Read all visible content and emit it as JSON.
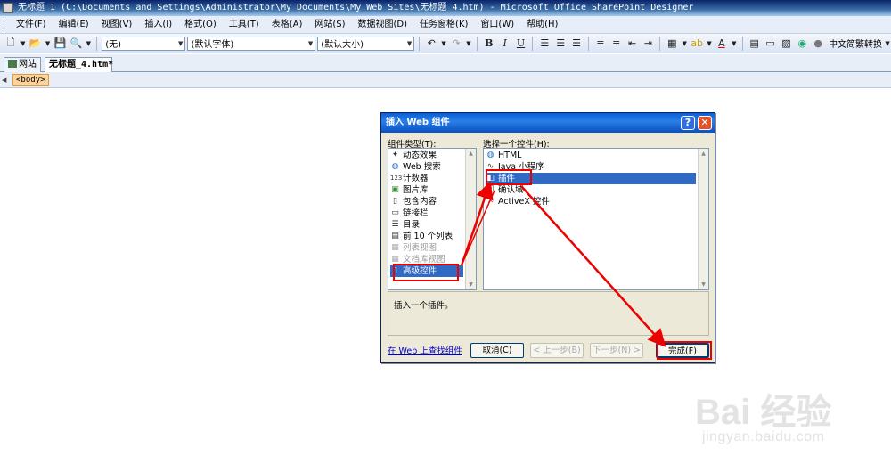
{
  "window": {
    "title": "无标题 1 (C:\\Documents and Settings\\Administrator\\My Documents\\My Web Sites\\无标题_4.htm) - Microsoft Office SharePoint Designer"
  },
  "menu": [
    "文件(F)",
    "编辑(E)",
    "视图(V)",
    "插入(I)",
    "格式(O)",
    "工具(T)",
    "表格(A)",
    "网站(S)",
    "数据视图(D)",
    "任务窗格(K)",
    "窗口(W)",
    "帮助(H)"
  ],
  "toolbar": {
    "style": "(无)",
    "font": "(默认字体)",
    "size": "(默认大小)",
    "bold": "B",
    "italic": "I",
    "underline": "U",
    "convert": "中文简繁转换"
  },
  "tabs": {
    "site": "网站",
    "doc": "无标题_4.htm*"
  },
  "tagbar": {
    "tag": "<body>"
  },
  "dialog": {
    "title": "插入 Web 组件",
    "help": "?",
    "close": "✕",
    "left_label": "组件类型(T):",
    "right_label": "选择一个控件(H):",
    "component_types": [
      {
        "label": "动态效果",
        "icon": "effects-icon"
      },
      {
        "label": "Web 搜索",
        "icon": "globe-search-icon"
      },
      {
        "label": "计数器",
        "icon": "counter-icon"
      },
      {
        "label": "图片库",
        "icon": "picture-library-icon"
      },
      {
        "label": "包含内容",
        "icon": "include-content-icon"
      },
      {
        "label": "链接栏",
        "icon": "link-bar-icon"
      },
      {
        "label": "目录",
        "icon": "toc-icon"
      },
      {
        "label": "前 10 个列表",
        "icon": "top10-icon"
      },
      {
        "label": "列表视图",
        "icon": "list-view-icon",
        "disabled": true
      },
      {
        "label": "文档库视图",
        "icon": "doc-library-icon",
        "disabled": true
      },
      {
        "label": "高级控件",
        "icon": "advanced-controls-icon",
        "selected": true
      }
    ],
    "controls": [
      {
        "label": "HTML",
        "icon": "html-icon"
      },
      {
        "label": "Java 小程序",
        "icon": "java-applet-icon"
      },
      {
        "label": "插件",
        "icon": "plugin-icon",
        "selected": true
      },
      {
        "label": "确认域",
        "icon": "confirmation-field-icon"
      },
      {
        "label": "ActiveX 控件",
        "icon": "activex-icon"
      }
    ],
    "description": "插入一个插件。",
    "find_link": "在 Web 上查找组件",
    "cancel": "取消(C)",
    "back": "< 上一步(B)",
    "next": "下一步(N) >",
    "finish": "完成(F)"
  },
  "watermark": {
    "logo": "Bai 经验",
    "url": "jingyan.baidu.com"
  },
  "colors": {
    "annotation": "#e00000",
    "selection": "#316ac5",
    "dialog_face": "#ece9d8"
  }
}
